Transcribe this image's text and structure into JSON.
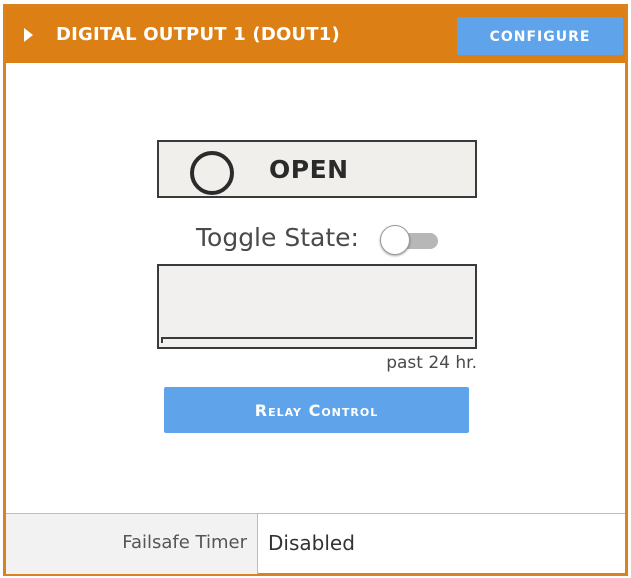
{
  "header": {
    "title": "DIGITAL OUTPUT 1 (DOUT1)",
    "configure_label": "CONFIGURE"
  },
  "state": {
    "label": "OPEN",
    "indicator_icon": "circle-open-icon"
  },
  "toggle": {
    "label": "Toggle State:",
    "on": false
  },
  "history": {
    "caption": "past 24 hr."
  },
  "relay_button": {
    "label": "Relay Control"
  },
  "footer": {
    "key": "Failsafe Timer",
    "value": "Disabled"
  },
  "colors": {
    "accent": "#dc7f15",
    "button": "#5fa4ea"
  }
}
